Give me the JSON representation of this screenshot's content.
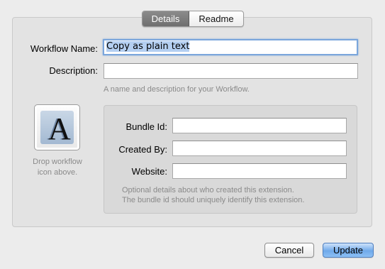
{
  "tabs": {
    "details": "Details",
    "readme": "Readme"
  },
  "form": {
    "workflow_name_label": "Workflow Name:",
    "workflow_name_value": "Copy as plain text",
    "description_label": "Description:",
    "description_value": "",
    "name_hint": "A name and description for your Workflow."
  },
  "icon_well": {
    "glyph": "A",
    "drop_hint_line1": "Drop workflow",
    "drop_hint_line2": "icon above."
  },
  "details": {
    "bundle_id_label": "Bundle Id:",
    "bundle_id_value": "",
    "created_by_label": "Created By:",
    "created_by_value": "",
    "website_label": "Website:",
    "website_value": "",
    "hint_line1": "Optional details about who created this extension.",
    "hint_line2": "The bundle id should uniquely identify this extension."
  },
  "buttons": {
    "cancel": "Cancel",
    "update": "Update"
  },
  "colors": {
    "window_bg": "#ececec",
    "focus_ring": "#7ba6dc",
    "selection": "#b4cff1",
    "primary_button": "#6fa9ea"
  }
}
